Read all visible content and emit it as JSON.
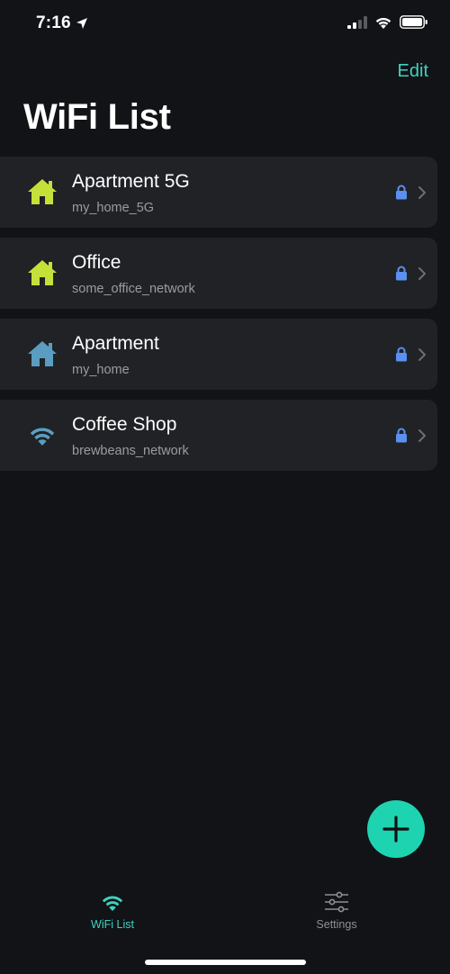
{
  "status_bar": {
    "time": "7:16",
    "location_icon": "location-arrow-icon",
    "signal_icon": "cellular-signal-icon",
    "wifi_icon": "wifi-icon",
    "battery_icon": "battery-icon"
  },
  "header": {
    "edit_label": "Edit",
    "title": "WiFi List"
  },
  "networks": [
    {
      "name": "Apartment 5G",
      "ssid": "my_home_5G",
      "icon": "home-icon",
      "icon_color": "#c6e03a",
      "locked": true
    },
    {
      "name": "Office",
      "ssid": "some_office_network",
      "icon": "home-icon",
      "icon_color": "#c6e03a",
      "locked": true
    },
    {
      "name": "Apartment",
      "ssid": "my_home",
      "icon": "home-icon",
      "icon_color": "#5b9dc0",
      "locked": true
    },
    {
      "name": "Coffee Shop",
      "ssid": "brewbeans_network",
      "icon": "wifi-icon",
      "icon_color": "#5b9dc0",
      "locked": true
    }
  ],
  "fab": {
    "icon": "plus-icon"
  },
  "tabs": [
    {
      "label": "WiFi List",
      "icon": "wifi-icon",
      "active": true
    },
    {
      "label": "Settings",
      "icon": "sliders-icon",
      "active": false
    }
  ],
  "colors": {
    "accent": "#3fd2c0",
    "fab": "#1ed3b0",
    "lock": "#5b8ff0",
    "background": "#121317",
    "row_background": "#202226"
  }
}
